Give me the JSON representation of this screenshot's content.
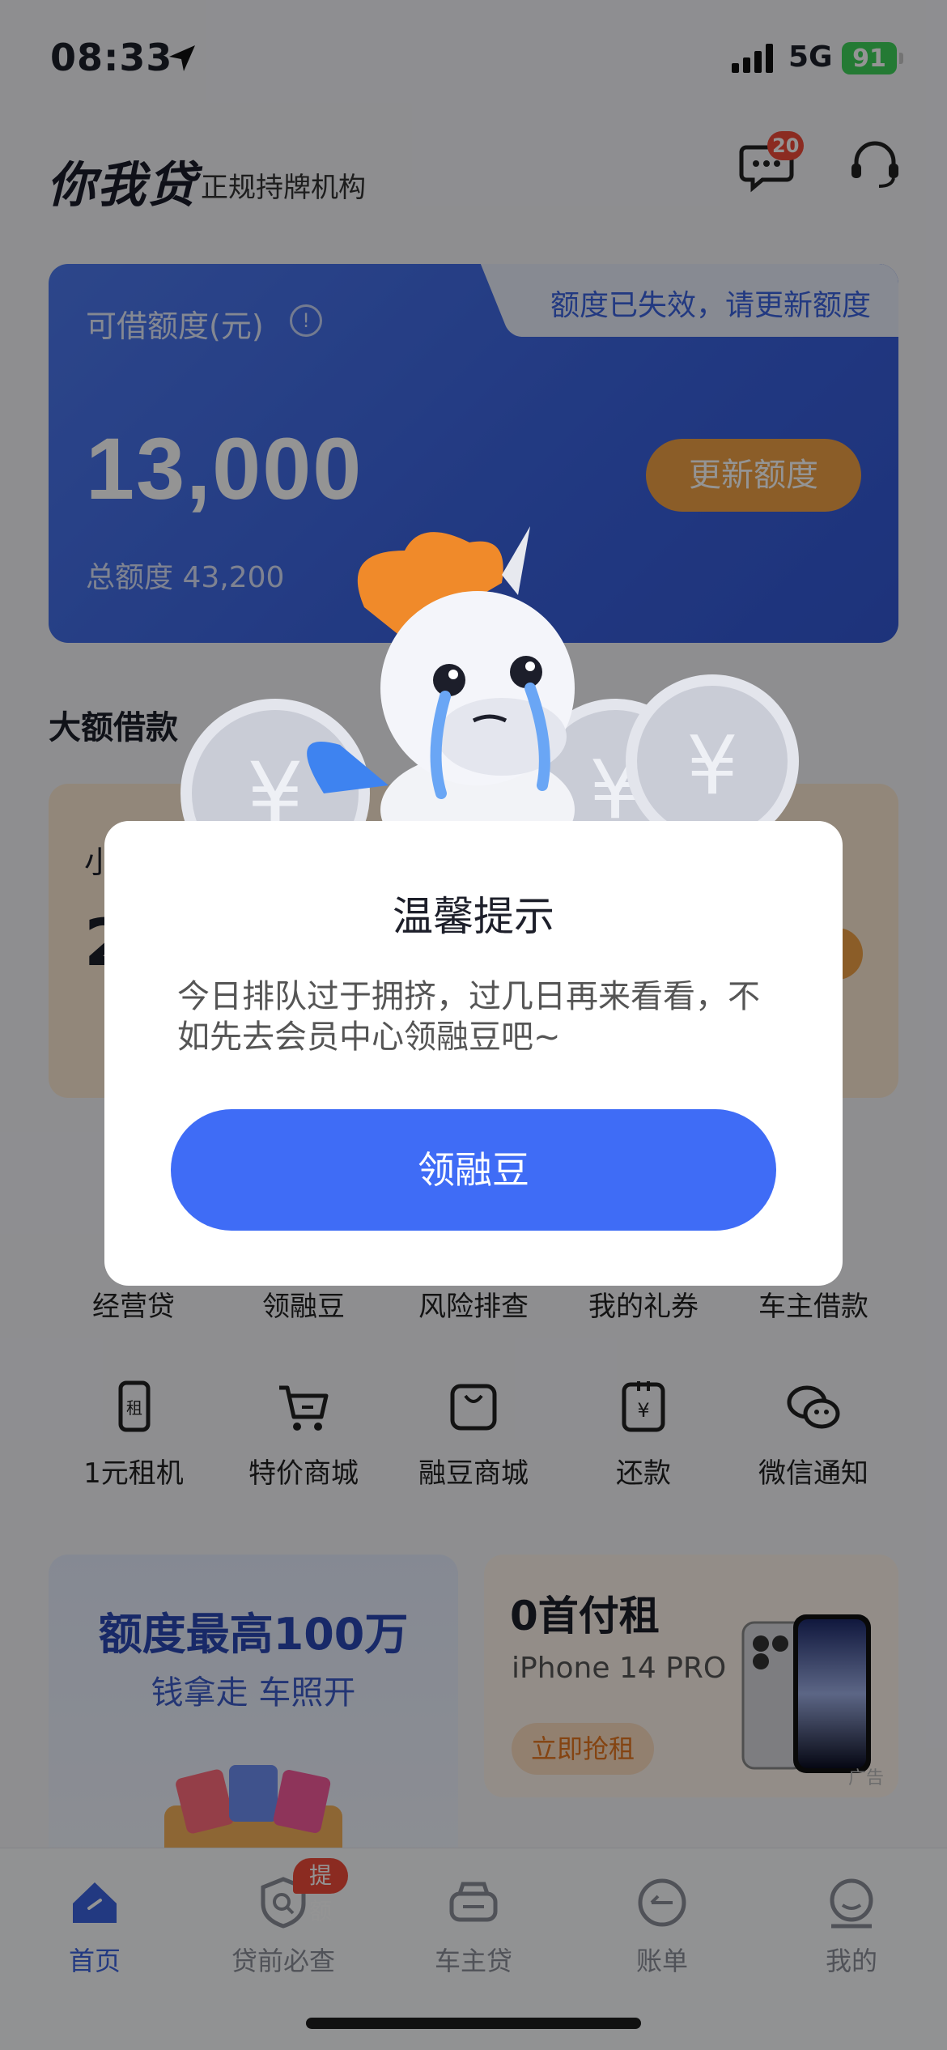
{
  "status_bar": {
    "time": "08:33",
    "network": "5G",
    "battery": "91"
  },
  "header": {
    "logo": "你我贷",
    "subtitle": "正规持牌机构",
    "message_badge": "20"
  },
  "credit_card": {
    "tab_text": "额度已失效，请更新额度",
    "label": "可借额度(元)",
    "amount": "13,000",
    "total": "总额度 43,200",
    "update_button": "更新额度"
  },
  "big_loan": {
    "section_title": "大额借款",
    "line1": "小",
    "line2": "2"
  },
  "grid_row1": [
    {
      "label": "经营贷",
      "icon": "business-loan-icon"
    },
    {
      "label": "领融豆",
      "icon": "beans-icon"
    },
    {
      "label": "风险排查",
      "icon": "risk-check-icon"
    },
    {
      "label": "我的礼券",
      "icon": "coupon-icon"
    },
    {
      "label": "车主借款",
      "icon": "car-loan-icon"
    }
  ],
  "grid_row2": [
    {
      "label": "1元租机",
      "icon": "phone-rent-icon"
    },
    {
      "label": "特价商城",
      "icon": "cart-icon"
    },
    {
      "label": "融豆商城",
      "icon": "bag-icon"
    },
    {
      "label": "还款",
      "icon": "repay-icon"
    },
    {
      "label": "微信通知",
      "icon": "wechat-icon"
    }
  ],
  "promo_left": {
    "title": "额度最高100万",
    "subtitle": "钱拿走 车照开"
  },
  "promo_right": {
    "title": "0首付租",
    "subtitle": "iPhone 14 PRO",
    "button": "立即抢租",
    "ad": "广告"
  },
  "tab_bar": [
    {
      "label": "首页",
      "icon": "home-icon",
      "active": true
    },
    {
      "label": "贷前必查",
      "icon": "shield-search-icon",
      "badge": "提额"
    },
    {
      "label": "车主贷",
      "icon": "car-icon"
    },
    {
      "label": "账单",
      "icon": "bill-icon"
    },
    {
      "label": "我的",
      "icon": "profile-icon"
    }
  ],
  "dialog": {
    "title": "温馨提示",
    "body": "今日排队过于拥挤，过几日再来看看，不如先去会员中心领融豆吧~",
    "button": "领融豆"
  },
  "colors": {
    "primary": "#3f6cf6",
    "accent": "#f0a145",
    "badge": "#f04a3a"
  }
}
